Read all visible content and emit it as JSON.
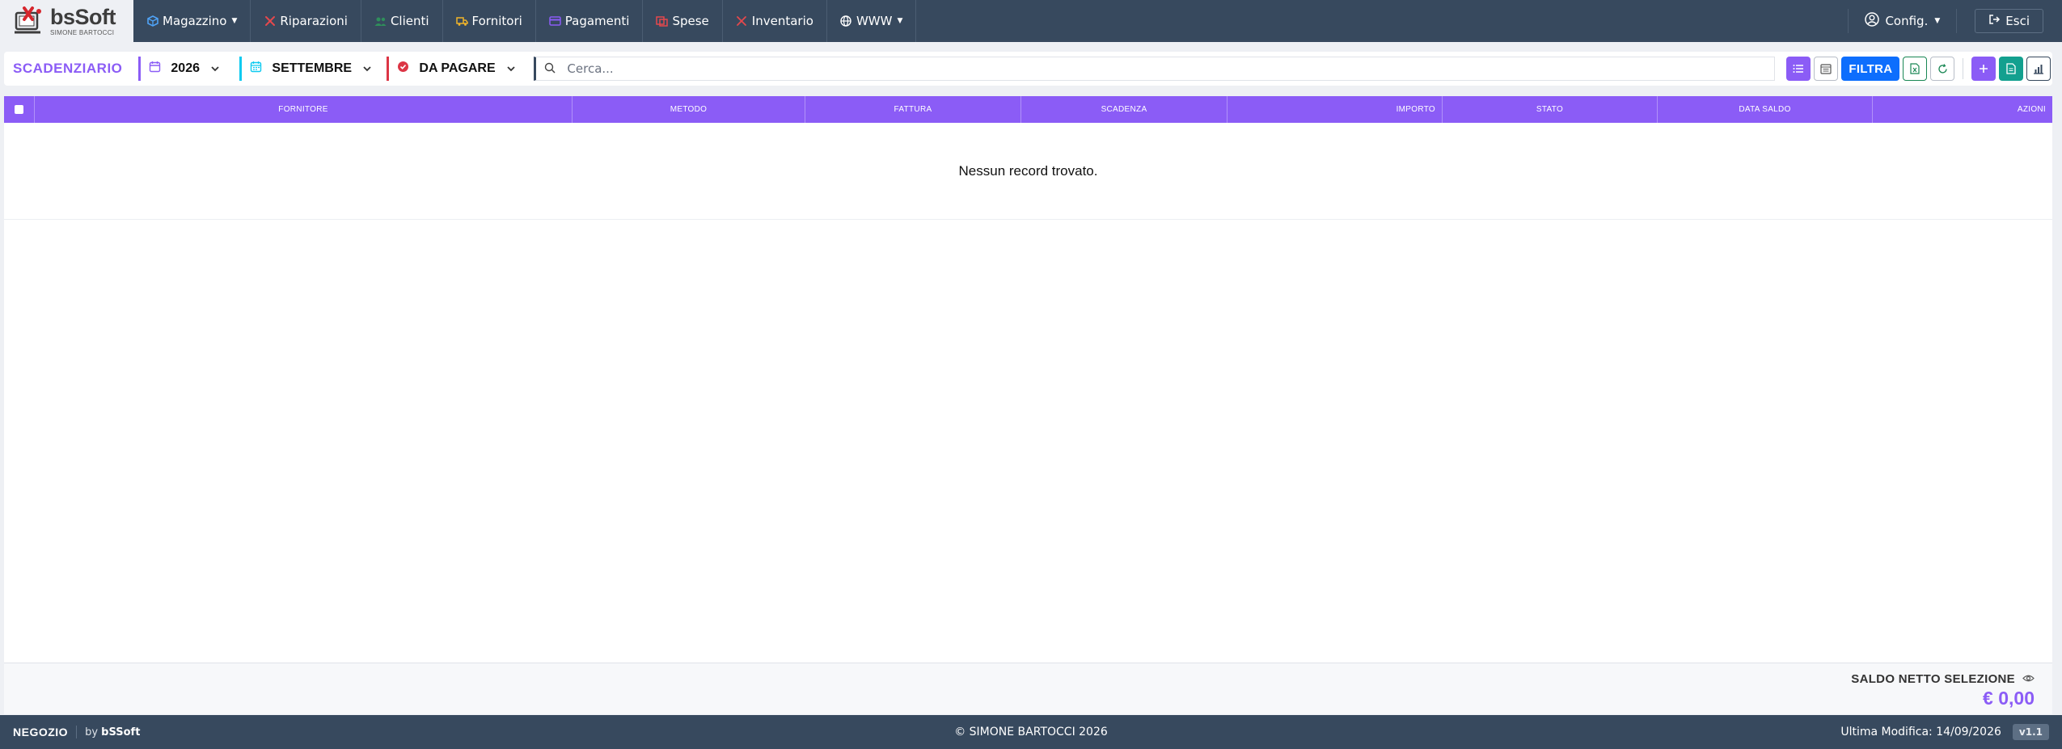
{
  "brand": {
    "name": "bsSoft",
    "subtitle": "SIMONE BARTOCCI"
  },
  "nav": {
    "items": [
      {
        "label": "Magazzino",
        "icon": "box-icon",
        "dropdown": true,
        "color": "#4fa3f7"
      },
      {
        "label": "Riparazioni",
        "icon": "tools-icon",
        "dropdown": false,
        "color": "#e5484d"
      },
      {
        "label": "Clienti",
        "icon": "users-icon",
        "dropdown": false,
        "color": "#2f8f5b"
      },
      {
        "label": "Fornitori",
        "icon": "truck-icon",
        "dropdown": false,
        "color": "#f0b429"
      },
      {
        "label": "Pagamenti",
        "icon": "card-icon",
        "dropdown": false,
        "color": "#8b5cf6"
      },
      {
        "label": "Spese",
        "icon": "receipt-icon",
        "dropdown": false,
        "color": "#e5484d"
      },
      {
        "label": "Inventario",
        "icon": "wrench-icon",
        "dropdown": false,
        "color": "#e5484d"
      },
      {
        "label": "WWW",
        "icon": "globe-icon",
        "dropdown": true,
        "color": "#ffffff"
      }
    ],
    "config_label": "Config.",
    "logout_label": "Esci"
  },
  "toolbar": {
    "title": "SCADENZIARIO",
    "year": "2026",
    "month": "SETTEMBRE",
    "status": "DA PAGARE",
    "search_placeholder": "Cerca...",
    "filter_label": "FILTRA"
  },
  "table": {
    "columns": [
      "FORNITORE",
      "METODO",
      "FATTURA",
      "SCADENZA",
      "IMPORTO",
      "STATO",
      "DATA SALDO",
      "AZIONI"
    ],
    "empty_message": "Nessun record trovato."
  },
  "summary": {
    "label": "SALDO NETTO SELEZIONE",
    "value": "€ 0,00"
  },
  "footer": {
    "shop": "NEGOZIO",
    "by_prefix": "by",
    "by_name": "bSSoft",
    "copyright": "© SIMONE BARTOCCI 2026",
    "last_modified": "Ultima Modifica: 14/09/2026",
    "version": "v1.1"
  },
  "colors": {
    "accent": "#8b5cf6",
    "navbar": "#37495e",
    "primary": "#0d6efd",
    "teal": "#13a08f"
  }
}
